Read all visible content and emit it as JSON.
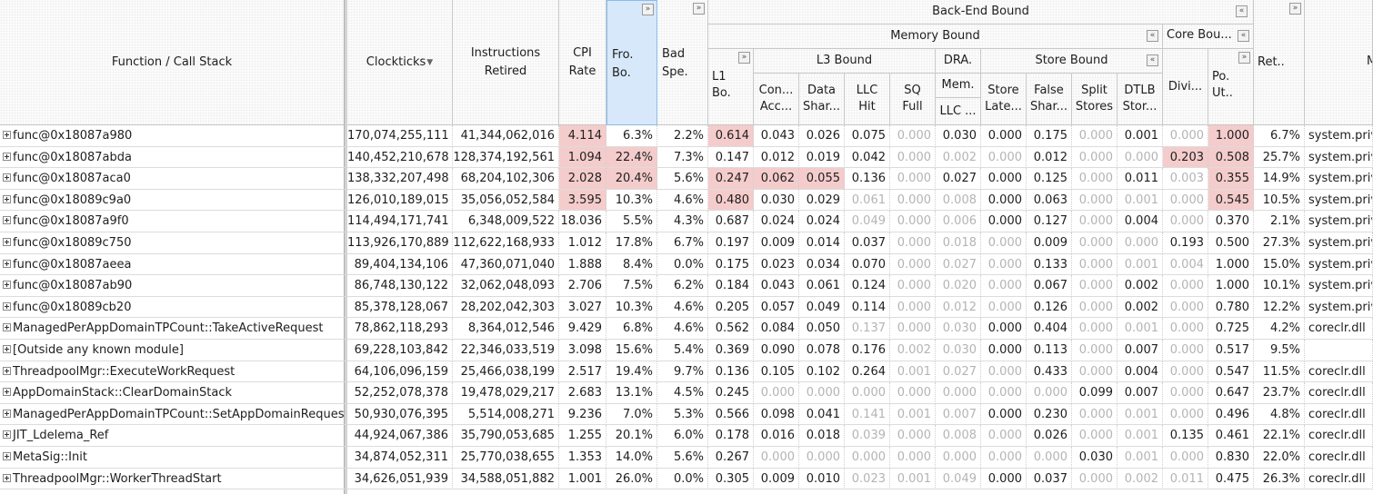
{
  "header": {
    "function": "Function / Call Stack",
    "clockticks": "Clockticks",
    "instructions": "Instructions\nRetired",
    "cpi": "CPI\nRate",
    "fro": "Fro.\nBo.",
    "bad": "Bad\nSpe.",
    "backend": "Back-End Bound",
    "memory": "Memory Bound",
    "core": "Core Bou...",
    "l1": "L1\nBo.",
    "l3": "L3 Bound",
    "dra": "DRA.",
    "store": "Store Bound",
    "con": "Con...\nAcc...",
    "data": "Data\nShar...",
    "llchit": "LLC\nHit",
    "sq": "SQ\nFull",
    "mem": "Mem.",
    "llc": "LLC ...",
    "storelat": "Store\nLate...",
    "falseshar": "False\nShar...",
    "split": "Split\nStores",
    "dtlb": "DTLB\nStor...",
    "divi": "Divi...",
    "pout": "Po.\nUt..",
    "ret": "Ret..",
    "module": "M",
    "expand_glyph": "»",
    "collapse_glyph": "«",
    "sort_glyph": "▼"
  },
  "colors": {
    "highlight": "#f4cccc",
    "selected_header": "#d6e8fa",
    "dim_text": "#b4b4b4"
  },
  "rows": [
    {
      "name": "func@0x18087a980",
      "clk": "170,074,255,111",
      "ins": "41,344,062,016",
      "cpi": "4.114",
      "fro": "6.3%",
      "bad": "2.2%",
      "l1": "0.614",
      "con": "0.043",
      "data": "0.026",
      "llchit": "0.075",
      "sq": "0.000",
      "mem": "0.030",
      "sl": "0.000",
      "fs": "0.175",
      "ss": "0.000",
      "dtlb": "0.001",
      "divi": "0.000",
      "po": "1.000",
      "ret": "6.7%",
      "mod": "system.priv",
      "hl": [
        "cpi",
        "l1",
        "po"
      ],
      "dim": [
        "sq",
        "ss",
        "divi"
      ]
    },
    {
      "name": "func@0x18087abda",
      "clk": "140,452,210,678",
      "ins": "128,374,192,561",
      "cpi": "1.094",
      "fro": "22.4%",
      "bad": "7.3%",
      "l1": "0.147",
      "con": "0.012",
      "data": "0.019",
      "llchit": "0.042",
      "sq": "0.000",
      "mem": "0.002",
      "sl": "0.000",
      "fs": "0.012",
      "ss": "0.000",
      "dtlb": "0.000",
      "divi": "0.203",
      "po": "0.508",
      "ret": "25.7%",
      "mod": "system.priv",
      "hl": [
        "cpi",
        "fro",
        "divi",
        "po"
      ],
      "dim": [
        "sq",
        "mem",
        "sl",
        "ss",
        "dtlb"
      ]
    },
    {
      "name": "func@0x18087aca0",
      "clk": "138,332,207,498",
      "ins": "68,204,102,306",
      "cpi": "2.028",
      "fro": "20.4%",
      "bad": "5.6%",
      "l1": "0.247",
      "con": "0.062",
      "data": "0.055",
      "llchit": "0.136",
      "sq": "0.000",
      "mem": "0.027",
      "sl": "0.000",
      "fs": "0.125",
      "ss": "0.000",
      "dtlb": "0.011",
      "divi": "0.003",
      "po": "0.355",
      "ret": "14.9%",
      "mod": "system.priv",
      "hl": [
        "cpi",
        "fro",
        "l1",
        "con",
        "data",
        "po"
      ],
      "dim": [
        "sq",
        "ss",
        "divi"
      ]
    },
    {
      "name": "func@0x18089c9a0",
      "clk": "126,010,189,015",
      "ins": "35,056,052,584",
      "cpi": "3.595",
      "fro": "10.3%",
      "bad": "4.6%",
      "l1": "0.480",
      "con": "0.030",
      "data": "0.029",
      "llchit": "0.061",
      "sq": "0.000",
      "mem": "0.008",
      "sl": "0.000",
      "fs": "0.063",
      "ss": "0.000",
      "dtlb": "0.001",
      "divi": "0.000",
      "po": "0.545",
      "ret": "10.5%",
      "mod": "system.priv",
      "hl": [
        "cpi",
        "l1",
        "po"
      ],
      "dim": [
        "llchit",
        "sq",
        "mem",
        "ss",
        "dtlb",
        "divi"
      ]
    },
    {
      "name": "func@0x18087a9f0",
      "clk": "114,494,171,741",
      "ins": "6,348,009,522",
      "cpi": "18.036",
      "fro": "5.5%",
      "bad": "4.3%",
      "l1": "0.687",
      "con": "0.024",
      "data": "0.024",
      "llchit": "0.049",
      "sq": "0.000",
      "mem": "0.006",
      "sl": "0.000",
      "fs": "0.127",
      "ss": "0.000",
      "dtlb": "0.004",
      "divi": "0.000",
      "po": "0.370",
      "ret": "2.1%",
      "mod": "system.priv",
      "hl": [],
      "dim": [
        "llchit",
        "sq",
        "mem",
        "ss",
        "divi"
      ]
    },
    {
      "name": "func@0x18089c750",
      "clk": "113,926,170,889",
      "ins": "112,622,168,933",
      "cpi": "1.012",
      "fro": "17.8%",
      "bad": "6.7%",
      "l1": "0.197",
      "con": "0.009",
      "data": "0.014",
      "llchit": "0.037",
      "sq": "0.000",
      "mem": "0.018",
      "sl": "0.000",
      "fs": "0.009",
      "ss": "0.000",
      "dtlb": "0.000",
      "divi": "0.193",
      "po": "0.500",
      "ret": "27.3%",
      "mod": "system.priv",
      "hl": [],
      "dim": [
        "sq",
        "mem",
        "sl",
        "ss",
        "dtlb"
      ]
    },
    {
      "name": "func@0x18087aeea",
      "clk": "89,404,134,106",
      "ins": "47,360,071,040",
      "cpi": "1.888",
      "fro": "8.4%",
      "bad": "0.0%",
      "l1": "0.175",
      "con": "0.023",
      "data": "0.034",
      "llchit": "0.070",
      "sq": "0.000",
      "mem": "0.027",
      "sl": "0.000",
      "fs": "0.133",
      "ss": "0.000",
      "dtlb": "0.001",
      "divi": "0.004",
      "po": "1.000",
      "ret": "15.0%",
      "mod": "system.priv",
      "hl": [],
      "dim": [
        "sq",
        "mem",
        "sl",
        "ss",
        "dtlb",
        "divi"
      ]
    },
    {
      "name": "func@0x18087ab90",
      "clk": "86,748,130,122",
      "ins": "32,062,048,093",
      "cpi": "2.706",
      "fro": "7.5%",
      "bad": "6.2%",
      "l1": "0.184",
      "con": "0.043",
      "data": "0.061",
      "llchit": "0.124",
      "sq": "0.000",
      "mem": "0.020",
      "sl": "0.000",
      "fs": "0.067",
      "ss": "0.000",
      "dtlb": "0.002",
      "divi": "0.000",
      "po": "1.000",
      "ret": "10.1%",
      "mod": "system.priv",
      "hl": [],
      "dim": [
        "sq",
        "mem",
        "sl",
        "ss",
        "divi"
      ]
    },
    {
      "name": "func@0x18089cb20",
      "clk": "85,378,128,067",
      "ins": "28,202,042,303",
      "cpi": "3.027",
      "fro": "10.3%",
      "bad": "4.6%",
      "l1": "0.205",
      "con": "0.057",
      "data": "0.049",
      "llchit": "0.114",
      "sq": "0.000",
      "mem": "0.012",
      "sl": "0.000",
      "fs": "0.126",
      "ss": "0.000",
      "dtlb": "0.002",
      "divi": "0.000",
      "po": "0.780",
      "ret": "12.2%",
      "mod": "system.priv",
      "hl": [],
      "dim": [
        "sq",
        "mem",
        "sl",
        "ss",
        "divi"
      ]
    },
    {
      "name": "ManagedPerAppDomainTPCount::TakeActiveRequest",
      "clk": "78,862,118,293",
      "ins": "8,364,012,546",
      "cpi": "9.429",
      "fro": "6.8%",
      "bad": "4.6%",
      "l1": "0.562",
      "con": "0.084",
      "data": "0.050",
      "llchit": "0.137",
      "sq": "0.000",
      "mem": "0.030",
      "sl": "0.000",
      "fs": "0.404",
      "ss": "0.000",
      "dtlb": "0.001",
      "divi": "0.000",
      "po": "0.725",
      "ret": "4.2%",
      "mod": "coreclr.dll",
      "hl": [],
      "dim": [
        "llchit",
        "sq",
        "mem",
        "ss",
        "dtlb",
        "divi"
      ]
    },
    {
      "name": "[Outside any known module]",
      "clk": "69,228,103,842",
      "ins": "22,346,033,519",
      "cpi": "3.098",
      "fro": "15.6%",
      "bad": "5.4%",
      "l1": "0.369",
      "con": "0.090",
      "data": "0.078",
      "llchit": "0.176",
      "sq": "0.002",
      "mem": "0.030",
      "sl": "0.000",
      "fs": "0.113",
      "ss": "0.000",
      "dtlb": "0.007",
      "divi": "0.000",
      "po": "0.517",
      "ret": "9.5%",
      "mod": "",
      "hl": [],
      "dim": [
        "sq",
        "mem",
        "ss",
        "divi"
      ]
    },
    {
      "name": "ThreadpoolMgr::ExecuteWorkRequest",
      "clk": "64,106,096,159",
      "ins": "25,466,038,199",
      "cpi": "2.517",
      "fro": "19.4%",
      "bad": "9.7%",
      "l1": "0.136",
      "con": "0.105",
      "data": "0.102",
      "llchit": "0.264",
      "sq": "0.001",
      "mem": "0.027",
      "sl": "0.000",
      "fs": "0.433",
      "ss": "0.000",
      "dtlb": "0.004",
      "divi": "0.000",
      "po": "0.547",
      "ret": "11.5%",
      "mod": "coreclr.dll",
      "hl": [],
      "dim": [
        "sq",
        "mem",
        "sl",
        "ss",
        "divi"
      ]
    },
    {
      "name": "AppDomainStack::ClearDomainStack",
      "clk": "52,252,078,378",
      "ins": "19,478,029,217",
      "cpi": "2.683",
      "fro": "13.1%",
      "bad": "4.5%",
      "l1": "0.245",
      "con": "0.000",
      "data": "0.000",
      "llchit": "0.000",
      "sq": "0.000",
      "mem": "0.000",
      "sl": "0.000",
      "fs": "0.000",
      "ss": "0.099",
      "dtlb": "0.007",
      "divi": "0.000",
      "po": "0.647",
      "ret": "23.7%",
      "mod": "coreclr.dll",
      "hl": [],
      "dim": [
        "con",
        "data",
        "llchit",
        "sq",
        "mem",
        "sl",
        "fs",
        "divi"
      ]
    },
    {
      "name": "ManagedPerAppDomainTPCount::SetAppDomainRequests",
      "clk": "50,930,076,395",
      "ins": "5,514,008,271",
      "cpi": "9.236",
      "fro": "7.0%",
      "bad": "5.3%",
      "l1": "0.566",
      "con": "0.098",
      "data": "0.041",
      "llchit": "0.141",
      "sq": "0.001",
      "mem": "0.007",
      "sl": "0.000",
      "fs": "0.230",
      "ss": "0.000",
      "dtlb": "0.001",
      "divi": "0.000",
      "po": "0.496",
      "ret": "4.8%",
      "mod": "coreclr.dll",
      "hl": [],
      "dim": [
        "llchit",
        "sq",
        "mem",
        "ss",
        "dtlb",
        "divi"
      ]
    },
    {
      "name": "JIT_Ldelema_Ref",
      "clk": "44,924,067,386",
      "ins": "35,790,053,685",
      "cpi": "1.255",
      "fro": "20.1%",
      "bad": "6.0%",
      "l1": "0.178",
      "con": "0.016",
      "data": "0.018",
      "llchit": "0.039",
      "sq": "0.000",
      "mem": "0.008",
      "sl": "0.000",
      "fs": "0.026",
      "ss": "0.000",
      "dtlb": "0.001",
      "divi": "0.135",
      "po": "0.461",
      "ret": "22.1%",
      "mod": "coreclr.dll",
      "hl": [],
      "dim": [
        "llchit",
        "sq",
        "mem",
        "sl",
        "ss",
        "dtlb"
      ]
    },
    {
      "name": "MetaSig::Init",
      "clk": "34,874,052,311",
      "ins": "25,770,038,655",
      "cpi": "1.353",
      "fro": "14.0%",
      "bad": "5.6%",
      "l1": "0.267",
      "con": "0.000",
      "data": "0.000",
      "llchit": "0.000",
      "sq": "0.000",
      "mem": "0.000",
      "sl": "0.000",
      "fs": "0.000",
      "ss": "0.030",
      "dtlb": "0.001",
      "divi": "0.000",
      "po": "0.830",
      "ret": "22.0%",
      "mod": "coreclr.dll",
      "hl": [],
      "dim": [
        "con",
        "data",
        "llchit",
        "sq",
        "mem",
        "sl",
        "fs",
        "dtlb",
        "divi"
      ]
    },
    {
      "name": "ThreadpoolMgr::WorkerThreadStart",
      "clk": "34,626,051,939",
      "ins": "34,588,051,882",
      "cpi": "1.001",
      "fro": "26.0%",
      "bad": "0.0%",
      "l1": "0.305",
      "con": "0.009",
      "data": "0.010",
      "llchit": "0.023",
      "sq": "0.001",
      "mem": "0.049",
      "sl": "0.000",
      "fs": "0.037",
      "ss": "0.000",
      "dtlb": "0.002",
      "divi": "0.011",
      "po": "0.475",
      "ret": "26.3%",
      "mod": "coreclr.dll",
      "hl": [],
      "dim": [
        "llchit",
        "sq",
        "mem",
        "ss",
        "dtlb",
        "divi"
      ]
    }
  ]
}
